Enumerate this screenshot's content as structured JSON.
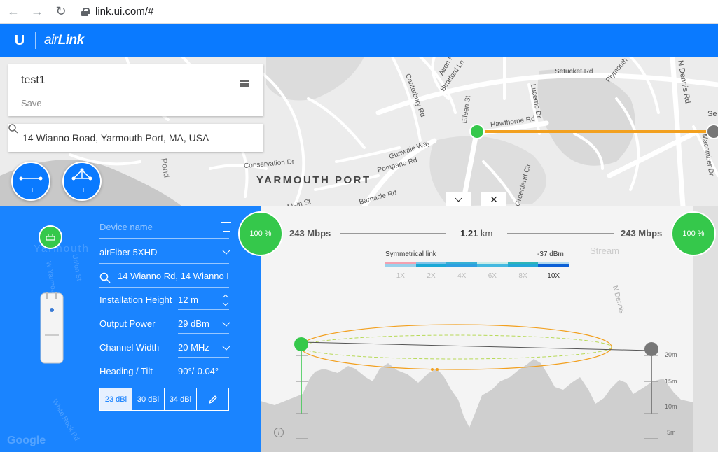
{
  "browser": {
    "url": "link.ui.com/#",
    "back_icon": "arrow-left-icon",
    "forward_icon": "arrow-right-icon",
    "reload_icon": "reload-icon"
  },
  "header": {
    "logo_mark": "U",
    "product_name_prefix": "air",
    "product_name": "Link"
  },
  "project": {
    "name": "test1",
    "save_label": "Save"
  },
  "search": {
    "value": "14 Wianno Road, Yarmouth Port, MA, USA"
  },
  "map": {
    "town_label": "YARMOUTH PORT",
    "roads": [
      "Setucket Rd",
      "Hawthorne Rd",
      "Eileen St",
      "Stratford Ln",
      "Canterbury Rd",
      "Avon Rd",
      "Gunwale Way",
      "Conservation Dr",
      "Pompano Rd",
      "Barnacle Rd",
      "Greenland Cir",
      "Lucerne Dr",
      "N Dennis Rd",
      "Macomber Dr",
      "Plymouth",
      "Se",
      "Pond",
      "Main St",
      "Yarmouth",
      "Union St",
      "W Yarmouth",
      "White Rock Rd",
      "Stream",
      "N Dennis",
      "Google"
    ],
    "link_color": "#f2a01f"
  },
  "device": {
    "name_label": "Device name",
    "model": "airFiber 5XHD",
    "location": "14 Wianno Rd, 14 Wianno R",
    "fields": [
      {
        "label": "Installation Height",
        "value": "12 m"
      },
      {
        "label": "Output Power",
        "value": "29 dBm"
      },
      {
        "label": "Channel Width",
        "value": "20 MHz"
      },
      {
        "label": "Heading / Tilt",
        "value": "90°/-0.04°"
      }
    ],
    "antennas": [
      "23 dBi",
      "30 dBi",
      "34 dBi"
    ],
    "selected_antenna": "23 dBi"
  },
  "link": {
    "left_quality": "100 %",
    "right_quality": "100 %",
    "left_throughput": "243 Mbps",
    "right_throughput": "243 Mbps",
    "distance_value": "1.21",
    "distance_unit": "km",
    "symmetry_label": "Symmetrical link",
    "signal": "-37 dBm",
    "modulation_scale": [
      "1X",
      "2X",
      "4X",
      "6X",
      "8X",
      "10X"
    ],
    "active_modulation": "10X",
    "elevation_ticks": [
      "20m",
      "15m",
      "10m",
      "5m"
    ],
    "status_color": "#35c84b",
    "accent_color": "#0a7aff"
  }
}
